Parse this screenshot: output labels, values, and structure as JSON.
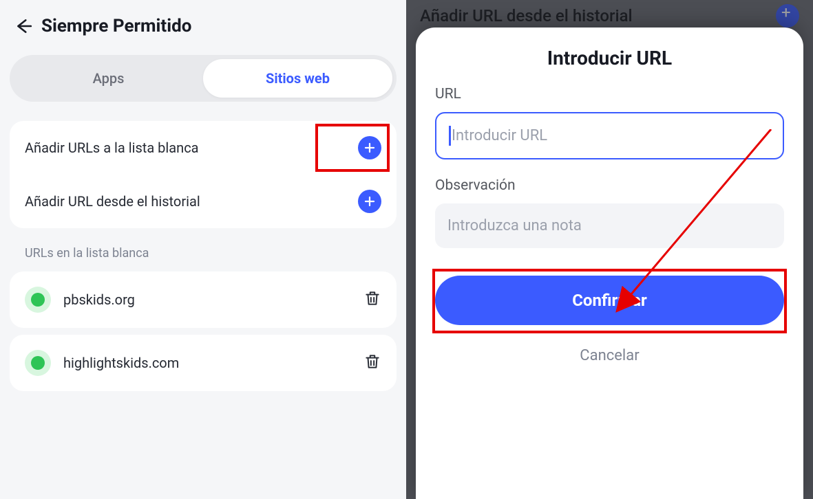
{
  "left": {
    "title": "Siempre Permitido",
    "tabs": {
      "apps": "Apps",
      "websites": "Sitios web"
    },
    "add_whitelist": "Añadir URLs a la lista blanca",
    "add_from_history": "Añadir URL desde el historial",
    "section_label": "URLs en la lista blanca",
    "urls": [
      "pbskids.org",
      "highlightskids.com"
    ]
  },
  "right": {
    "peek": "Añadir URL desde el historial",
    "dialog_title": "Introducir URL",
    "url_label": "URL",
    "url_placeholder": "Introducir URL",
    "note_label": "Observación",
    "note_placeholder": "Introduzca una nota",
    "confirm": "Confirmar",
    "cancel": "Cancelar"
  }
}
